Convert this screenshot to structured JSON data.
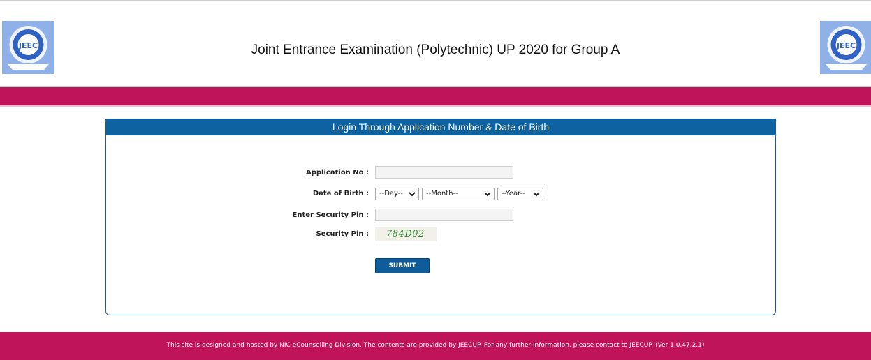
{
  "colors": {
    "brand": "#c0145a",
    "panel": "#0e62a0",
    "button": "#0e5c9a"
  },
  "header": {
    "title": "Joint Entrance Examination (Polytechnic) UP 2020 for Group A",
    "logo_text": "JEEC"
  },
  "login": {
    "title": "Login Through Application Number & Date of Birth",
    "application_no_label": "Application No :",
    "application_no_value": "",
    "dob_label": "Date of Birth :",
    "day_selected": "--Day--",
    "month_selected": "--Month--",
    "year_selected": "--Year--",
    "security_pin_input_label": "Enter Security Pin :",
    "security_pin_value": "",
    "security_pin_label": "Security Pin :",
    "captcha": "784D02",
    "submit_label": "SUBMIT"
  },
  "footer": {
    "text": "This site is designed and hosted by NIC eCounselling Division. The contents are provided by JEECUP. For any further information, please contact to JEECUP. (Ver 1.0.47.2.1)"
  }
}
